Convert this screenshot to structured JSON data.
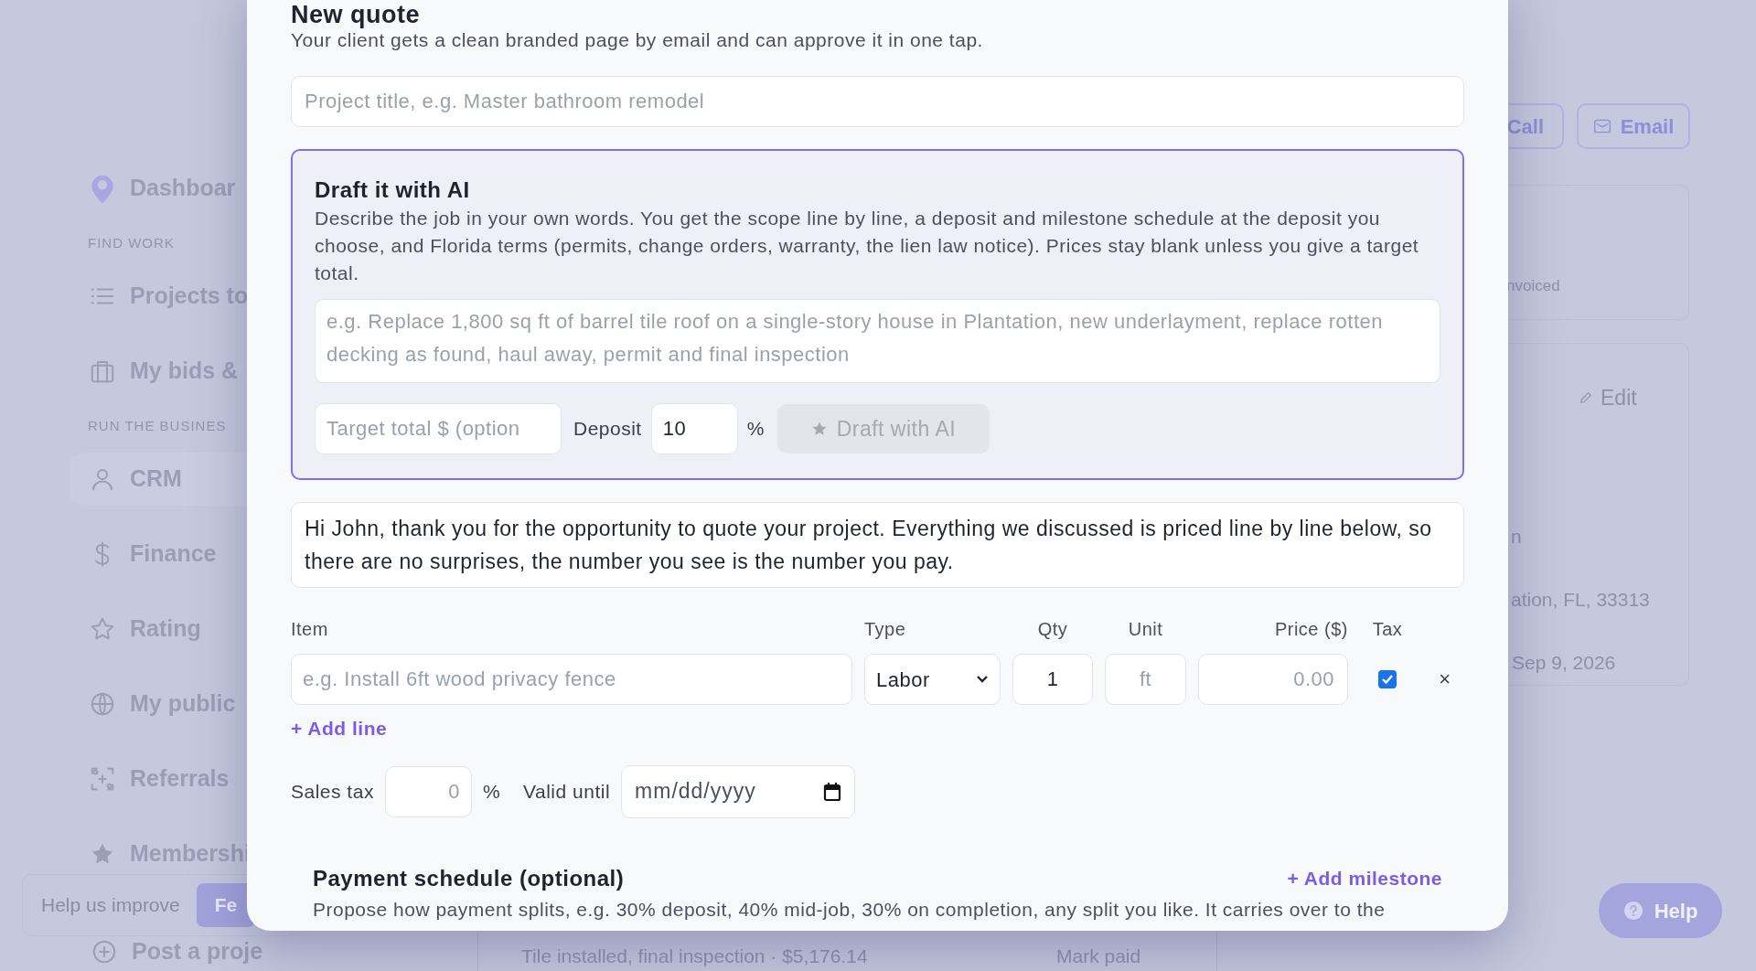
{
  "sidebar": {
    "items": [
      {
        "kind": "link",
        "label": "Dashboar",
        "selected": false
      },
      {
        "kind": "section",
        "label": "FIND WORK"
      },
      {
        "kind": "link",
        "label": "Projects to",
        "selected": false
      },
      {
        "kind": "link",
        "label": "My bids &",
        "selected": false
      },
      {
        "kind": "section",
        "label": "RUN THE BUSINES"
      },
      {
        "kind": "link",
        "label": "CRM",
        "selected": true
      },
      {
        "kind": "link",
        "label": "Finance",
        "selected": false
      },
      {
        "kind": "link",
        "label": "Rating",
        "selected": false
      },
      {
        "kind": "link",
        "label": "My public",
        "selected": false
      },
      {
        "kind": "link",
        "label": "Referrals",
        "selected": false
      },
      {
        "kind": "link",
        "label": "Membershi",
        "selected": false
      }
    ],
    "feedback": {
      "text": "Help us improve",
      "button": "Fe"
    },
    "post_project": "Post a proje"
  },
  "background": {
    "call_button": "Call",
    "email_button": "Email",
    "status_text": "nvoiced",
    "edit_button": "Edit",
    "detail_lines": [
      "n",
      "ation, FL, 33313",
      "Sep 9, 2026"
    ],
    "bottom_row": {
      "item": "Tile installed, final inspection · $5,176.14",
      "action": "Mark paid"
    },
    "help_button": "Help"
  },
  "modal": {
    "title": "New quote",
    "subtitle": "Your client gets a clean branded page by email and can approve it in one tap.",
    "project_title": {
      "placeholder": "Project title, e.g. Master bathroom remodel"
    },
    "ai_panel": {
      "title": "Draft it with AI",
      "description": "Describe the job in your own words. You get the scope line by line, a deposit and milestone schedule at the deposit you choose, and Florida terms (permits, change orders, warranty, the lien law notice). Prices stay blank unless you give a target total.",
      "job_field": {
        "placeholder": "e.g. Replace 1,800 sq ft of barrel tile roof on a single-story house in Plantation, new underlayment, replace rotten decking as found, haul away, permit and final inspection"
      },
      "target_field": {
        "placeholder": "Target total $ (option"
      },
      "deposit_label": "Deposit",
      "deposit_value": "10",
      "percent": "%",
      "draft_button": {
        "label": "Draft with AI",
        "disabled": true
      }
    },
    "message": "Hi John, thank you for the opportunity to quote your project. Everything we discussed is priced line by line below, so there are no surprises, the number you see is the number you pay.",
    "line_items": {
      "columns": [
        "Item",
        "Type",
        "Qty",
        "Unit",
        "Price ($)",
        "Tax"
      ],
      "rows": [
        {
          "item_placeholder": "e.g. Install 6ft wood privacy fence",
          "type": "Labor",
          "qty": "1",
          "unit_placeholder": "ft",
          "price_placeholder": "0.00",
          "taxable": true,
          "remove": "×"
        }
      ],
      "add_line": "+ Add line"
    },
    "sales_tax": {
      "label": "Sales tax",
      "placeholder": "0",
      "percent": "%"
    },
    "valid_until": {
      "label": "Valid until",
      "placeholder": "mm/dd/yyyy"
    },
    "payment_schedule": {
      "title": "Payment schedule (optional)",
      "add_milestone": "+ Add milestone",
      "description": "Propose how payment splits, e.g. 30% deposit, 40% mid-job, 30% on completion, any split you like. It carries over to the"
    }
  }
}
